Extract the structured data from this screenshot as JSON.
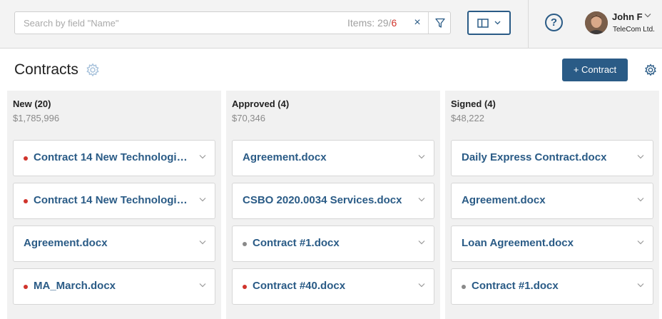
{
  "search": {
    "placeholder": "Search by field \"Name\"",
    "items_label": "Items: 29",
    "items_sep": "/",
    "items_filtered": "6",
    "clear_glyph": "×"
  },
  "user": {
    "name": "John F",
    "company": "TeleCom Ltd."
  },
  "help_glyph": "?",
  "page": {
    "title": "Contracts",
    "add_button": "+ Contract"
  },
  "colors": {
    "accent": "#2a5b86",
    "dot_red": "#d0342c",
    "dot_gray": "#8a8a8a"
  },
  "columns": [
    {
      "title": "New (20)",
      "sum": "$1,785,996",
      "cards": [
        {
          "name": "Contract 14 New Technologies...",
          "dot": "red"
        },
        {
          "name": "Contract 14 New Technologies...",
          "dot": "red"
        },
        {
          "name": "Agreement.docx",
          "dot": "none"
        },
        {
          "name": "MA_March.docx",
          "dot": "red"
        }
      ]
    },
    {
      "title": "Approved (4)",
      "sum": "$70,346",
      "cards": [
        {
          "name": "Agreement.docx",
          "dot": "none"
        },
        {
          "name": "CSBO 2020.0034 Services.docx",
          "dot": "none"
        },
        {
          "name": "Contract #1.docx",
          "dot": "gray"
        },
        {
          "name": "Contract #40.docx",
          "dot": "red"
        }
      ]
    },
    {
      "title": "Signed (4)",
      "sum": "$48,222",
      "cards": [
        {
          "name": "Daily Express Contract.docx",
          "dot": "none"
        },
        {
          "name": "Agreement.docx",
          "dot": "none"
        },
        {
          "name": "Loan Agreement.docx",
          "dot": "none"
        },
        {
          "name": "Contract #1.docx",
          "dot": "gray"
        }
      ]
    }
  ]
}
